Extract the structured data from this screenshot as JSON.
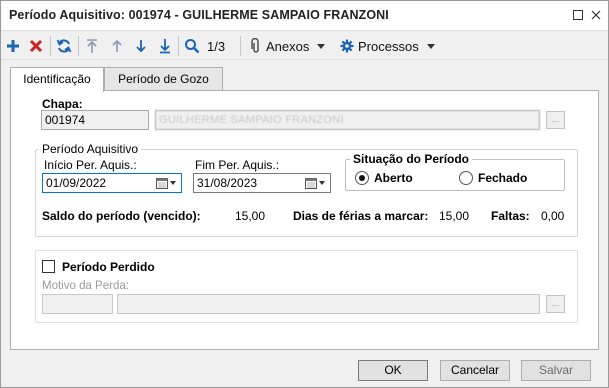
{
  "window": {
    "title": "Período Aquisitivo: 001974 - GUILHERME SAMPAIO FRANZONI"
  },
  "toolbar": {
    "record_position": "1/3",
    "attachments_label": "Anexos",
    "processes_label": "Processos"
  },
  "tabs": [
    {
      "label": "Identificação",
      "active": true
    },
    {
      "label": "Período de Gozo",
      "active": false
    }
  ],
  "identificacao": {
    "chapa_label": "Chapa:",
    "chapa_value": "001974",
    "nome_value": "GUILHERME SAMPAIO FRANZONI",
    "periodo_aquisitivo": {
      "group_label": "Período Aquisitivo",
      "inicio_label": "Início Per. Aquis.:",
      "inicio_value": "01/09/2022",
      "fim_label": "Fim Per. Aquis.:",
      "fim_value": "31/08/2023",
      "situacao_label": "Situação do Período",
      "situacao_options": [
        {
          "label": "Aberto",
          "checked": true
        },
        {
          "label": "Fechado",
          "checked": false
        }
      ],
      "saldo_label": "Saldo do período (vencido):",
      "saldo_value": "15,00",
      "dias_label": "Dias de férias a marcar:",
      "dias_value": "15,00",
      "faltas_label": "Faltas:",
      "faltas_value": "0,00"
    },
    "periodo_perdido": {
      "checkbox_label": "Período Perdido",
      "checked": false,
      "motivo_label": "Motivo da Perda:",
      "motivo_code": "",
      "motivo_desc": ""
    }
  },
  "footer": {
    "ok_label": "OK",
    "cancel_label": "Cancelar",
    "save_label": "Salvar"
  },
  "colors": {
    "accent_blue": "#1a64b5",
    "delete_red": "#cc2222",
    "focus_border": "#0078d7"
  }
}
